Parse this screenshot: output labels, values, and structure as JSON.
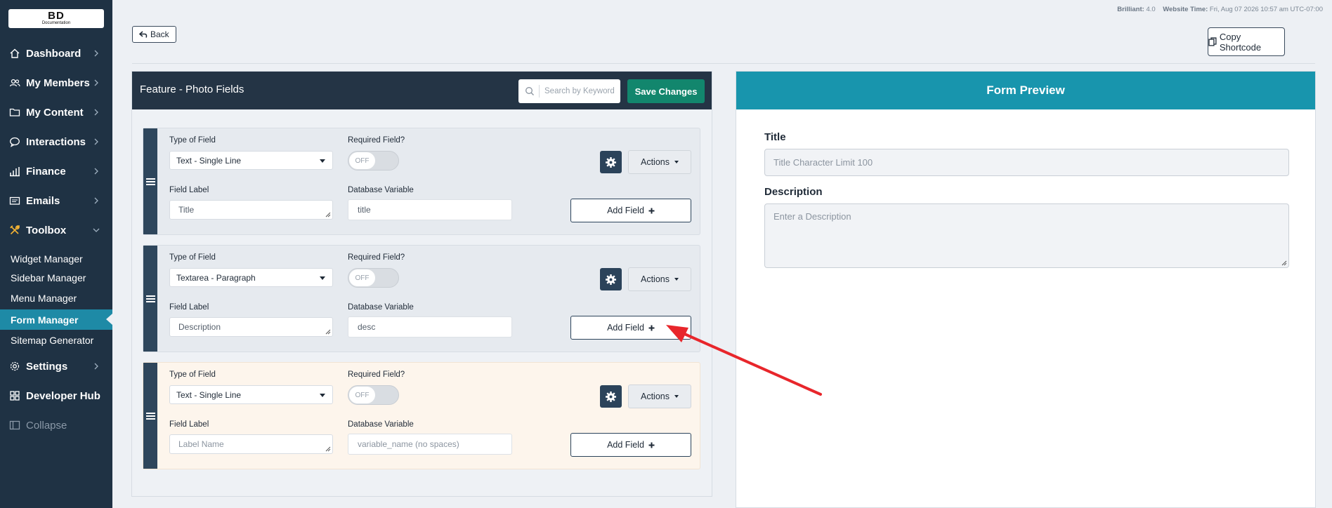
{
  "topbar": {
    "brilliant_label": "Brilliant:",
    "brilliant_value": "4.0",
    "website_time_label": "Website Time:",
    "website_time_value": "Fri, Aug 07 2026 10:57 am UTC-07:00",
    "back_label": "Back",
    "copy_shortcode_label": "Copy Shortcode"
  },
  "logo": {
    "line1": "BD",
    "line2": "Documentation"
  },
  "sidebar": {
    "items": [
      {
        "label": "Dashboard",
        "icon": "home-icon"
      },
      {
        "label": "My Members",
        "icon": "members-icon"
      },
      {
        "label": "My Content",
        "icon": "folder-icon"
      },
      {
        "label": "Interactions",
        "icon": "chat-icon"
      },
      {
        "label": "Finance",
        "icon": "bar-chart-icon"
      },
      {
        "label": "Emails",
        "icon": "email-icon"
      },
      {
        "label": "Toolbox",
        "icon": "tools-icon"
      }
    ],
    "toolbox_sub": [
      {
        "label": "Widget Manager"
      },
      {
        "label": "Sidebar Manager"
      },
      {
        "label": "Menu Manager"
      },
      {
        "label": "Form Manager",
        "active": true
      },
      {
        "label": "Sitemap Generator"
      }
    ],
    "bottom_items": [
      {
        "label": "Settings",
        "icon": "gear-icon"
      },
      {
        "label": "Developer Hub",
        "icon": "grid-icon"
      },
      {
        "label": "Collapse",
        "icon": "collapse-icon"
      }
    ]
  },
  "form_panel": {
    "title": "Feature - Photo Fields",
    "search_placeholder": "Search by Keyword",
    "save_label": "Save Changes",
    "labels": {
      "type_of_field": "Type of Field",
      "required_field": "Required Field?",
      "field_label": "Field Label",
      "database_variable": "Database Variable",
      "actions": "Actions",
      "add_field": "Add Field",
      "toggle_off": "OFF"
    },
    "rows": [
      {
        "type": "Text - Single Line",
        "field_label": "Title",
        "db_variable": "title"
      },
      {
        "type": "Textarea - Paragraph",
        "field_label": "Description",
        "db_variable": "desc"
      },
      {
        "type": "Text - Single Line",
        "field_label_placeholder": "Label Name",
        "db_variable_placeholder": "variable_name (no spaces)"
      }
    ]
  },
  "preview": {
    "title": "Form Preview",
    "fields": [
      {
        "label": "Title",
        "placeholder": "Title Character Limit 100"
      },
      {
        "label": "Description",
        "placeholder": "Enter a Description"
      }
    ]
  },
  "colors": {
    "sidebar_bg": "#1f3244",
    "accent_teal": "#1895ad",
    "save_green": "#12866d",
    "panel_header": "#243445",
    "annotation_arrow": "#e8262b"
  }
}
